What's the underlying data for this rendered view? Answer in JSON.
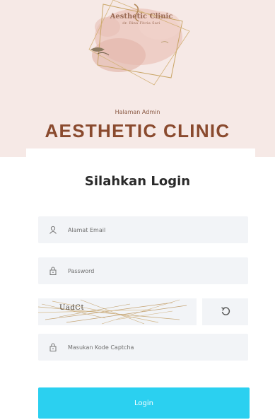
{
  "header": {
    "logo_title": "Aesthetic Clinic",
    "logo_subtitle": "dr. Rina Fitria Sari",
    "subtitle": "Halaman Admin",
    "title": "AESTHETIC CLINIC"
  },
  "login": {
    "title": "Silahkan Login",
    "email_placeholder": "Alamat Email",
    "password_placeholder": "Password",
    "captcha_text": "UadCt",
    "captcha_placeholder": "Masukan Kode Captcha",
    "submit_label": "Login"
  },
  "icons": {
    "email": "user-icon",
    "password": "lock-icon",
    "captcha": "lock-icon",
    "refresh": "refresh-icon"
  },
  "colors": {
    "header_bg": "#f6e9e6",
    "title_color": "#8a4a2e",
    "button_bg": "#2bd0f0",
    "field_bg": "#f2f4f7"
  }
}
